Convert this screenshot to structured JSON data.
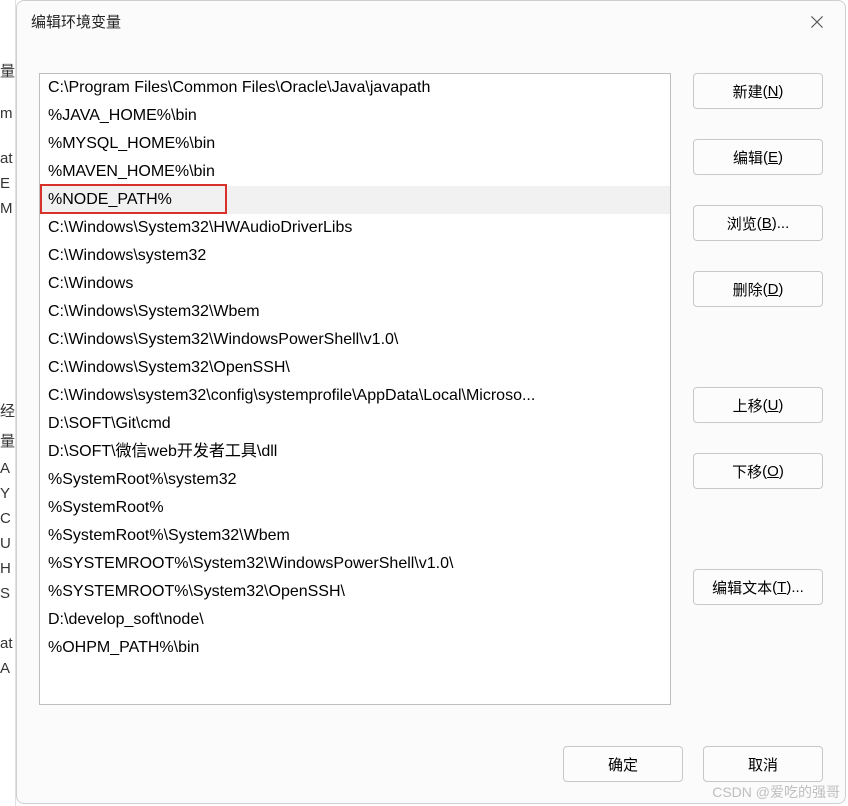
{
  "title": "编辑环境变量",
  "paths": [
    "C:\\Program Files\\Common Files\\Oracle\\Java\\javapath",
    "%JAVA_HOME%\\bin",
    "%MYSQL_HOME%\\bin",
    "%MAVEN_HOME%\\bin",
    "%NODE_PATH%",
    "C:\\Windows\\System32\\HWAudioDriverLibs",
    "C:\\Windows\\system32",
    "C:\\Windows",
    "C:\\Windows\\System32\\Wbem",
    "C:\\Windows\\System32\\WindowsPowerShell\\v1.0\\",
    "C:\\Windows\\System32\\OpenSSH\\",
    "C:\\Windows\\system32\\config\\systemprofile\\AppData\\Local\\Microso...",
    "D:\\SOFT\\Git\\cmd",
    "D:\\SOFT\\微信web开发者工具\\dll",
    "%SystemRoot%\\system32",
    "%SystemRoot%",
    "%SystemRoot%\\System32\\Wbem",
    "%SYSTEMROOT%\\System32\\WindowsPowerShell\\v1.0\\",
    "%SYSTEMROOT%\\System32\\OpenSSH\\",
    "D:\\develop_soft\\node\\",
    "%OHPM_PATH%\\bin"
  ],
  "selected_index": 4,
  "buttons": {
    "new": {
      "label": "新建",
      "accel": "N"
    },
    "edit": {
      "label": "编辑",
      "accel": "E"
    },
    "browse": {
      "label": "浏览",
      "accel": "B",
      "suffix": "..."
    },
    "delete": {
      "label": "删除",
      "accel": "D"
    },
    "up": {
      "label": "上移",
      "accel": "U"
    },
    "down": {
      "label": "下移",
      "accel": "O"
    },
    "edit_text": {
      "label": "编辑文本",
      "accel": "T",
      "suffix": "..."
    }
  },
  "bottom": {
    "ok": "确定",
    "cancel": "取消"
  },
  "watermark": "CSDN @爱吃的强哥",
  "bg_fragments": [
    "量",
    "m",
    "at",
    "E",
    "M",
    "",
    "经",
    "量",
    "A",
    "Y",
    "C",
    "U",
    "H",
    "S",
    "at",
    "A"
  ]
}
